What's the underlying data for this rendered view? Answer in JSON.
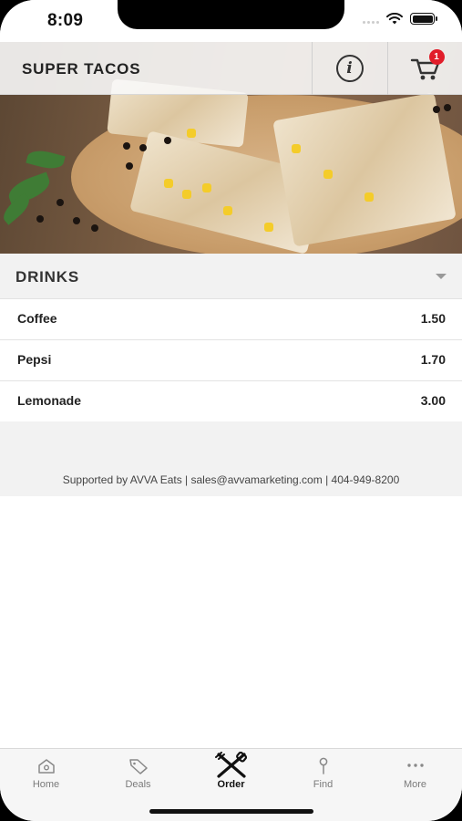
{
  "status_bar": {
    "time": "8:09"
  },
  "header": {
    "title": "SUPER TACOS",
    "info_icon": "info-icon",
    "cart_icon": "cart-icon",
    "cart_count": "1",
    "badge_color": "#e11d2a"
  },
  "section": {
    "title": "DRINKS"
  },
  "menu_items": [
    {
      "name": "Coffee",
      "price": "1.50"
    },
    {
      "name": "Pepsi",
      "price": "1.70"
    },
    {
      "name": "Lemonade",
      "price": "3.00"
    }
  ],
  "footer": {
    "text": "Supported by AVVA Eats | sales@avvamarketing.com | 404-949-8200"
  },
  "tabs": [
    {
      "label": "Home",
      "icon": "home-icon"
    },
    {
      "label": "Deals",
      "icon": "tag-icon"
    },
    {
      "label": "Order",
      "icon": "utensils-icon",
      "active": true
    },
    {
      "label": "Find",
      "icon": "pin-icon"
    },
    {
      "label": "More",
      "icon": "more-icon"
    }
  ]
}
